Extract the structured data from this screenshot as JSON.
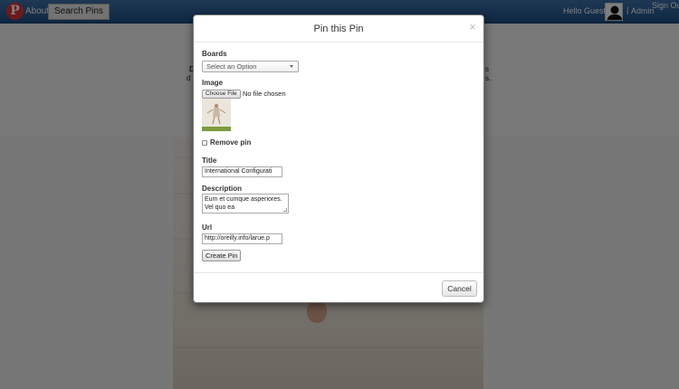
{
  "navbar": {
    "logo_letter": "P",
    "about": "About",
    "search_pins": "Search Pins",
    "hello": "Hello Guest!",
    "separator": "|",
    "admin": "Admin",
    "sign_out": "Sign Out"
  },
  "hero": {
    "fragment_left": "D",
    "fragment_left2": "d",
    "fragment_right": "s",
    "fragment_right2": "s."
  },
  "modal": {
    "title": "Pin this Pin",
    "close_glyph": "×",
    "boards_label": "Boards",
    "boards_placeholder": "Select an Option",
    "image_label": "Image",
    "choose_file": "Choose File",
    "no_file": "No file chosen",
    "remove_pin_label": "Remove pin",
    "title_label": "Title",
    "title_value": "International Configurati",
    "description_label": "Description",
    "description_value": "Eum et cumque asperiores. Vel quo ea",
    "url_label": "Url",
    "url_value": "http://oreilly.info/larue.p",
    "create_pin": "Create Pin",
    "cancel": "Cancel"
  },
  "icons": {
    "logo": "pinterest-logo-icon",
    "avatar": "user-silhouette-icon",
    "close": "close-icon",
    "dropdown": "chevron-down-icon"
  },
  "colors": {
    "navbar": "#2a5d96",
    "logo": "#dd3333",
    "overlay": "rgba(0,0,0,0.5)"
  }
}
